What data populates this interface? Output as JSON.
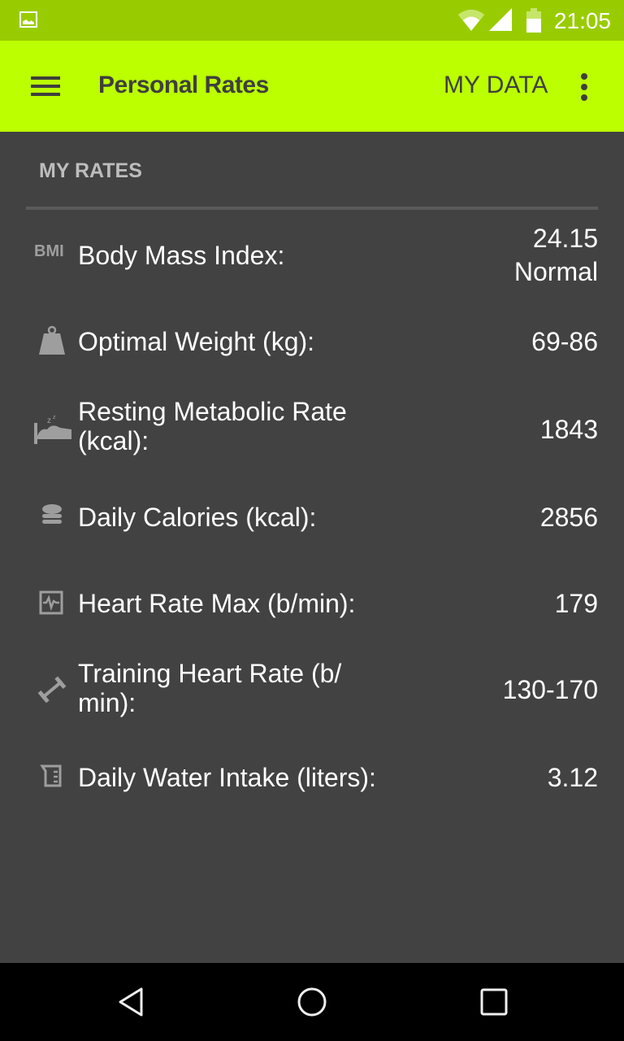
{
  "status_bar": {
    "time": "21:05",
    "icons": [
      "image-notification-icon",
      "wifi-icon",
      "signal-icon",
      "battery-icon"
    ]
  },
  "app_bar": {
    "title": "Personal Rates",
    "action": "MY DATA",
    "menu_icon": "hamburger-menu-icon",
    "overflow_icon": "overflow-menu-icon"
  },
  "section_title": "MY RATES",
  "rates": [
    {
      "icon": "bmi-icon",
      "icon_text": "BMI",
      "label": "Body Mass Index:",
      "value": "24.15",
      "value2": "Normal"
    },
    {
      "icon": "weight-icon",
      "label": "Optimal Weight (kg):",
      "value": "69-86"
    },
    {
      "icon": "bed-sleep-icon",
      "label": "Resting Metabolic Rate (kcal):",
      "value": "1843"
    },
    {
      "icon": "food-stack-icon",
      "label": "Daily Calories (kcal):",
      "value": "2856"
    },
    {
      "icon": "heart-monitor-icon",
      "label": "Heart Rate Max (b/min):",
      "value": "179"
    },
    {
      "icon": "dumbbell-icon",
      "label": "Training Heart Rate (b/ min):",
      "value": "130-170"
    },
    {
      "icon": "beaker-icon",
      "label": "Daily Water Intake (liters):",
      "value": "3.12"
    }
  ],
  "nav_bar": [
    "back-icon",
    "home-icon",
    "recents-icon"
  ]
}
